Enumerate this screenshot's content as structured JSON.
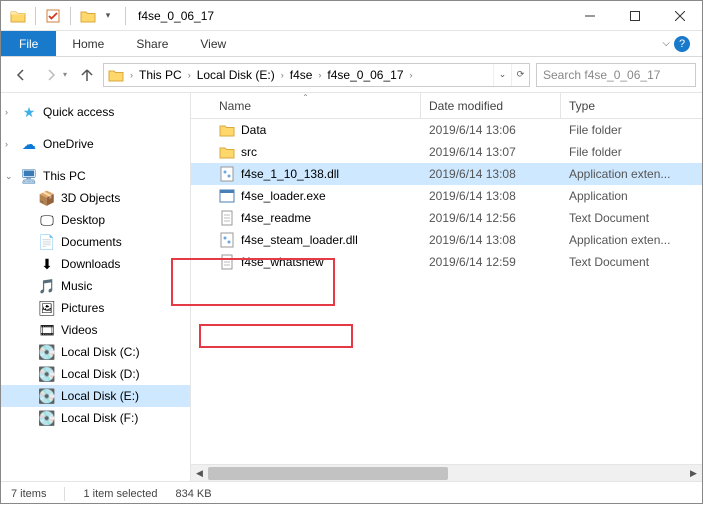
{
  "titlebar": {
    "title": "f4se_0_06_17"
  },
  "ribbon": {
    "file": "File",
    "home": "Home",
    "share": "Share",
    "view": "View"
  },
  "breadcrumbs": [
    "This PC",
    "Local Disk  (E:)",
    "f4se",
    "f4se_0_06_17"
  ],
  "search_placeholder": "Search f4se_0_06_17",
  "columns": {
    "name": "Name",
    "date": "Date modified",
    "type": "Type"
  },
  "nav": {
    "quick": "Quick access",
    "onedrive": "OneDrive",
    "thispc": "This PC",
    "subs": [
      "3D Objects",
      "Desktop",
      "Documents",
      "Downloads",
      "Music",
      "Pictures",
      "Videos",
      "Local Disk (C:)",
      "Local Disk  (D:)",
      "Local Disk  (E:)",
      "Local Disk (F:)"
    ]
  },
  "files": [
    {
      "name": "Data",
      "date": "2019/6/14 13:06",
      "type": "File folder",
      "icon": "folder",
      "selected": false
    },
    {
      "name": "src",
      "date": "2019/6/14 13:07",
      "type": "File folder",
      "icon": "folder",
      "selected": false
    },
    {
      "name": "f4se_1_10_138.dll",
      "date": "2019/6/14 13:08",
      "type": "Application exten...",
      "icon": "dll",
      "selected": true
    },
    {
      "name": "f4se_loader.exe",
      "date": "2019/6/14 13:08",
      "type": "Application",
      "icon": "exe",
      "selected": false
    },
    {
      "name": "f4se_readme",
      "date": "2019/6/14 12:56",
      "type": "Text Document",
      "icon": "txt",
      "selected": false
    },
    {
      "name": "f4se_steam_loader.dll",
      "date": "2019/6/14 13:08",
      "type": "Application exten...",
      "icon": "dll",
      "selected": false
    },
    {
      "name": "f4se_whatsnew",
      "date": "2019/6/14 12:59",
      "type": "Text Document",
      "icon": "txt",
      "selected": false
    }
  ],
  "status": {
    "count": "7 items",
    "selected": "1 item selected",
    "size": "834 KB"
  }
}
